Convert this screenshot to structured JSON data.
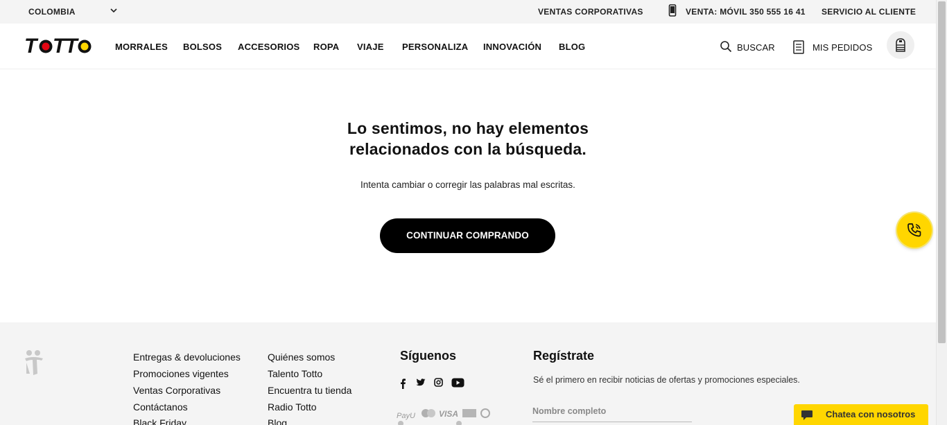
{
  "topbar": {
    "country": "COLOMBIA",
    "corporate": "VENTAS CORPORATIVAS",
    "phone": "VENTA: MÓVIL 350 555 16 41",
    "service": "SERVICIO AL CLIENTE"
  },
  "header": {
    "brand": "TOTTO",
    "nav": [
      "MORRALES",
      "BOLSOS",
      "ACCESORIOS",
      "ROPA",
      "VIAJE",
      "PERSONALIZA",
      "INNOVACIÓN",
      "BLOG"
    ],
    "search_label": "BUSCAR",
    "orders_label": "MIS PEDIDOS"
  },
  "main": {
    "title_line1": "Lo sentimos, no hay elementos",
    "title_line2": "relacionados con la búsqueda.",
    "subtitle": "Intenta cambiar o corregir las palabras mal escritas.",
    "cta": "CONTINUAR COMPRANDO"
  },
  "footer": {
    "col1": [
      "Entregas & devoluciones",
      "Promociones vigentes",
      "Ventas Corporativas",
      "Contáctanos",
      "Black Friday"
    ],
    "col2": [
      "Quiénes somos",
      "Talento Totto",
      "Encuentra tu tienda",
      "Radio Totto",
      "Blog"
    ],
    "social_heading": "Síguenos",
    "register_heading": "Regístrate",
    "register_text": "Sé el primero en recibir noticias de ofertas y promociones especiales.",
    "name_placeholder": "Nombre completo",
    "payment_logos": [
      "PayU",
      "VISA"
    ]
  },
  "chat": {
    "label": "Chatea con nosotros"
  },
  "colors": {
    "accent": "#ffd600",
    "brand_red": "#e30613",
    "dark": "#000000"
  }
}
